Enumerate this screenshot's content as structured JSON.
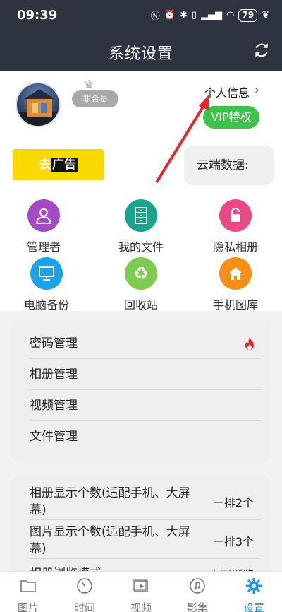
{
  "status": {
    "time": "09:39",
    "battery": "79"
  },
  "header": {
    "title": "系统设置"
  },
  "profile": {
    "member_badge": "非会员",
    "personal_info": "个人信息",
    "vip_label": "VIP特权"
  },
  "promo": {
    "ad_part1": "去",
    "ad_part2": "广告",
    "cloud_label": "云端数据:"
  },
  "grid": [
    {
      "label": "管理者",
      "icon": "person-icon",
      "color": "#a34ac4"
    },
    {
      "label": "我的文件",
      "icon": "cabinet-icon",
      "color": "#1aa38c"
    },
    {
      "label": "隐私相册",
      "icon": "lock-icon",
      "color": "#ee4785"
    },
    {
      "label": "电脑备份",
      "icon": "monitor-icon",
      "color": "#1aa3e8"
    },
    {
      "label": "回收站",
      "icon": "recycle-icon",
      "color": "#7ecb52"
    },
    {
      "label": "手机图库",
      "icon": "home-icon",
      "color": "#fb8e14"
    }
  ],
  "menu": [
    {
      "label": "密码管理",
      "badge": "fire-icon"
    },
    {
      "label": "相册管理"
    },
    {
      "label": "视频管理"
    },
    {
      "label": "文件管理"
    }
  ],
  "settings": [
    {
      "label": "相册显示个数(适配手机、大屏幕)",
      "value": "一排2个"
    },
    {
      "label": "图片显示个数(适配手机、大屏幕)",
      "value": "一排3个"
    },
    {
      "label": "相册浏览模式",
      "value": "小图浏览"
    }
  ],
  "tabs": [
    {
      "label": "图片",
      "icon": "folder-icon"
    },
    {
      "label": "时间",
      "icon": "clock-icon"
    },
    {
      "label": "视频",
      "icon": "video-icon"
    },
    {
      "label": "影集",
      "icon": "music-icon"
    },
    {
      "label": "设置",
      "icon": "gear-icon",
      "active": true
    }
  ],
  "colors": {
    "header_bg": "#2e3340",
    "vip_green": "#3cc24a",
    "ad_yellow": "#fad900",
    "accent_blue": "#1e9be8",
    "annotation_red": "#e8252c"
  }
}
